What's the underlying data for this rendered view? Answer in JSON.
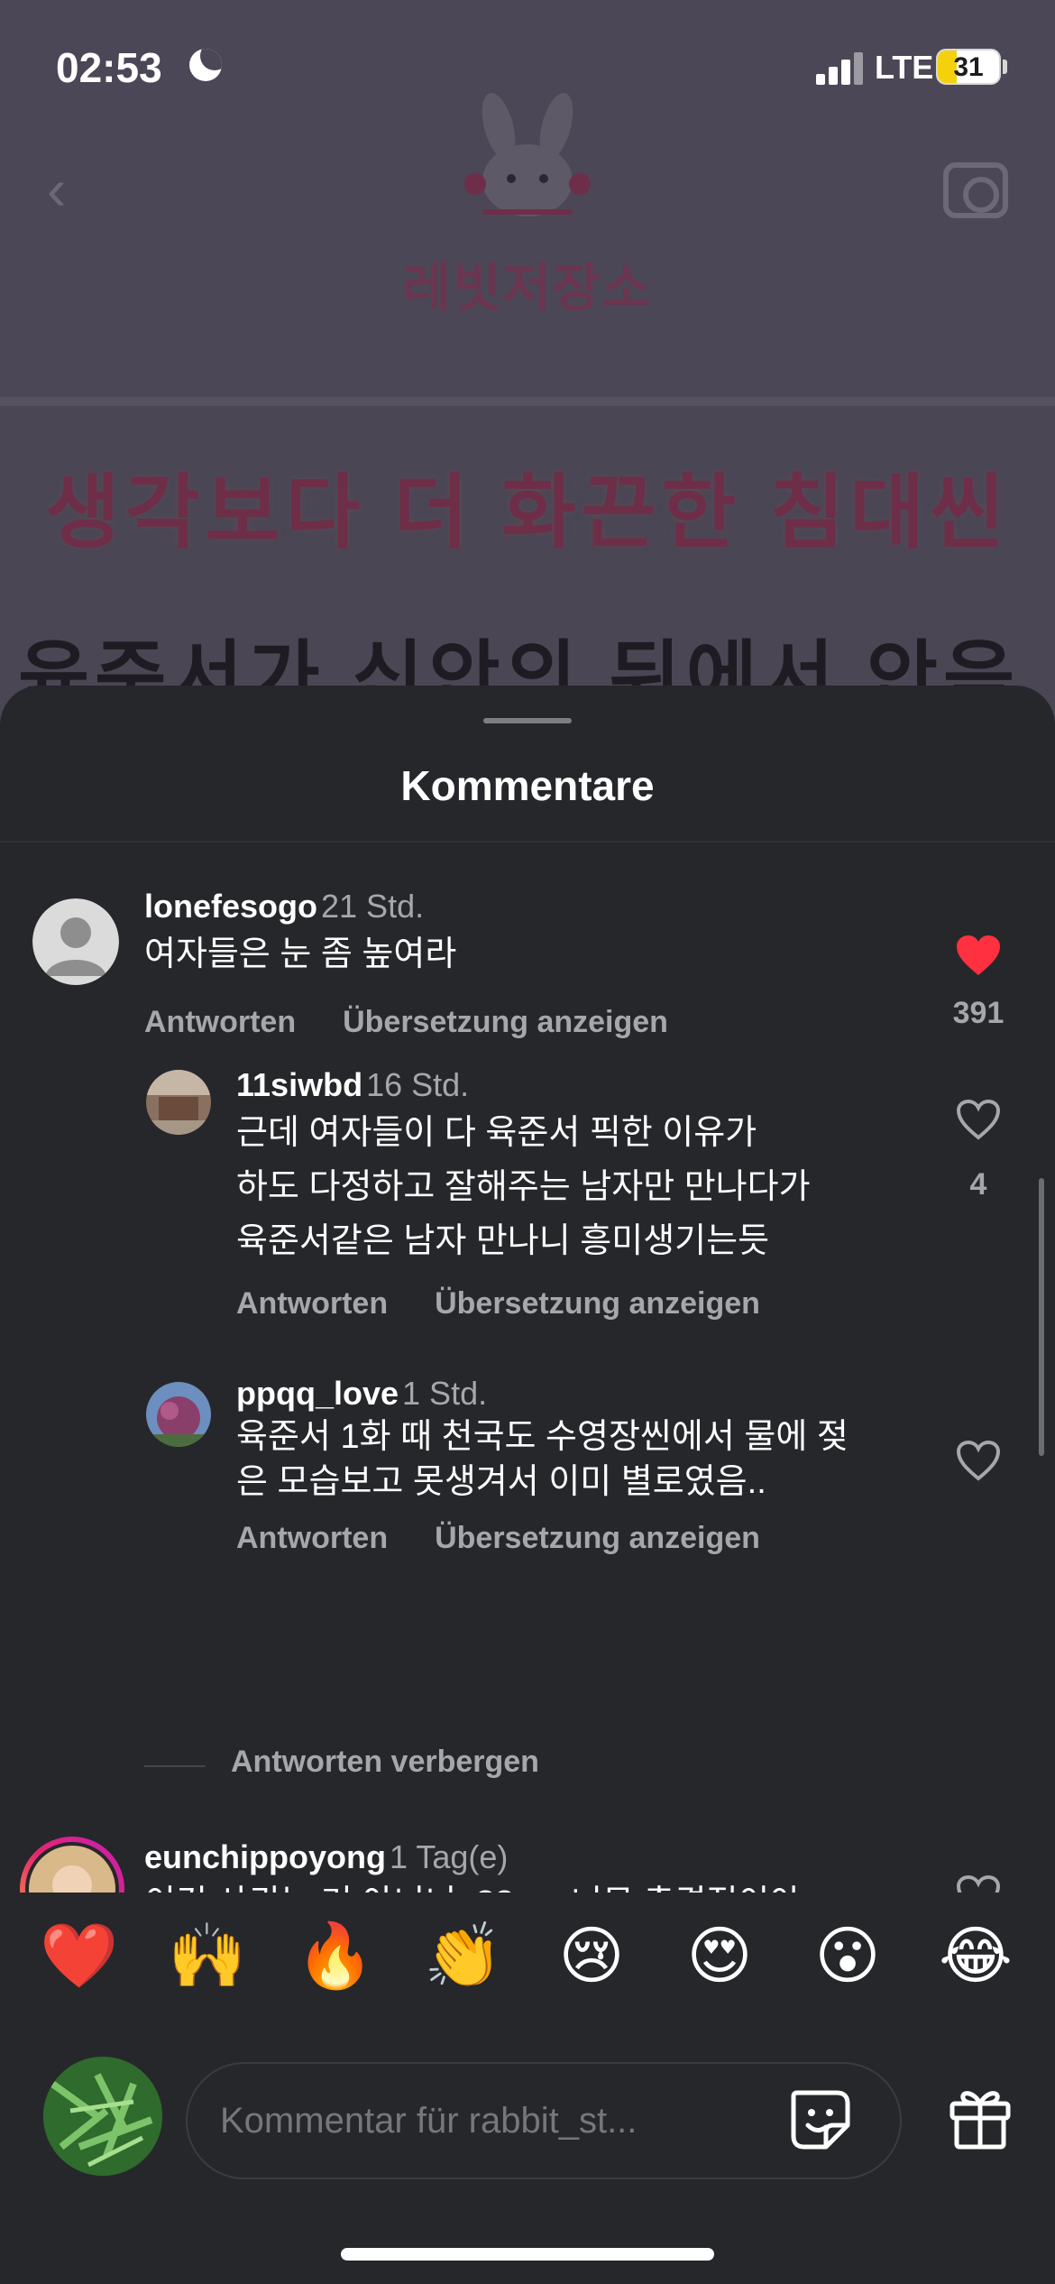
{
  "status_bar": {
    "time": "02:53",
    "network": "LTE",
    "battery": "31",
    "battery_level": 0.31
  },
  "background_post": {
    "logo_text": "레빗저장소",
    "title": "생각보다 더 화끈한 침대씬",
    "subtitle": "육준서가 신안의 뒤에서 안음"
  },
  "sheet": {
    "title": "Kommentare",
    "reply_label": "Antworten",
    "translate_label": "Übersetzung anzeigen",
    "hide_replies_label": "Antworten verbergen"
  },
  "comments": [
    {
      "user": "lonefesogo",
      "time": "21 Std.",
      "lines": [
        "여자들은 눈 좀 높여라"
      ],
      "likes": "391",
      "liked": true
    },
    {
      "user": "11siwbd",
      "time": "16 Std.",
      "lines": [
        "근데 여자들이 다 육준서 픽한 이유가",
        "하도 다정하고 잘해주는 남자만 만나다가",
        "육준서같은 남자 만나니 흥미생기는듯"
      ],
      "likes": "4",
      "liked": false
    },
    {
      "user": "ppqq_love",
      "time": "1 Std.",
      "lines": [
        "육준서 1화 때 천국도 수영장씬에서  물에 젖",
        "은 모습보고 못생겨서 이미 별로였음.."
      ],
      "likes": "",
      "liked": false
    },
    {
      "user": "eunchippoyong",
      "time": "1 Tag(e)",
      "lines": [
        "이건 사귀는 거 아니니..?? .... 너무 충격적이야"
      ],
      "likes": "",
      "liked": false
    }
  ],
  "emoji_reactions": [
    "❤️",
    "🙌",
    "🔥",
    "👏",
    "😢",
    "😍",
    "😮",
    "😂"
  ],
  "composer": {
    "placeholder": "Kommentar für rabbit_st..."
  },
  "colors": {
    "like_red": "#ff3040",
    "sheet_bg": "#26272b",
    "muted_text": "#a6a7ab",
    "battery_yellow": "#f5d10c"
  }
}
